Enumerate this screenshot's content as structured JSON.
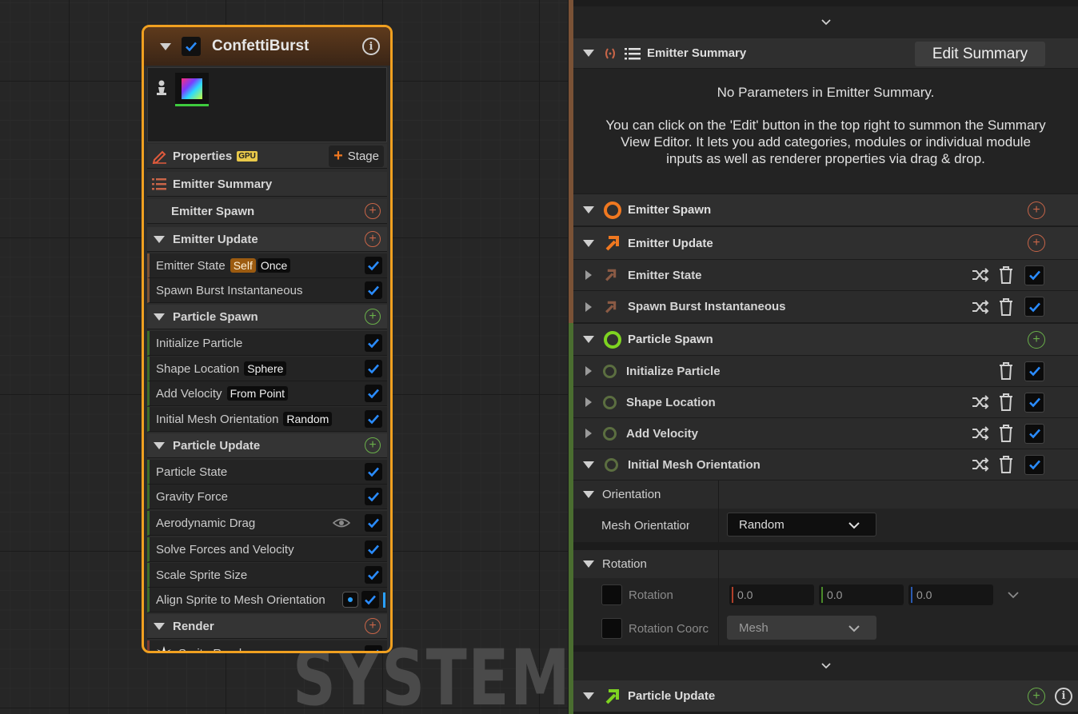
{
  "graph": {
    "watermark": "SYSTEM",
    "node": {
      "title": "ConfettiBurst",
      "properties_label": "Properties",
      "gpu_badge": "GPU",
      "stage_label": "Stage",
      "stage_plus": "+",
      "emitter_summary_label": "Emitter Summary",
      "emitter_spawn_label": "Emitter Spawn",
      "emitter_update_label": "Emitter Update",
      "emitter_state_label": "Emitter State",
      "emitter_state_badges": [
        "Self",
        "Once"
      ],
      "spawn_burst_label": "Spawn Burst Instantaneous",
      "particle_spawn_label": "Particle Spawn",
      "initialize_particle_label": "Initialize Particle",
      "shape_location_label": "Shape Location",
      "shape_location_badge": "Sphere",
      "add_velocity_label": "Add Velocity",
      "add_velocity_badge": "From Point",
      "initial_mesh_orientation_label": "Initial Mesh Orientation",
      "initial_mesh_orientation_badge": "Random",
      "particle_update_label": "Particle Update",
      "particle_state_label": "Particle State",
      "gravity_force_label": "Gravity Force",
      "aerodynamic_drag_label": "Aerodynamic Drag",
      "solve_forces_label": "Solve Forces and Velocity",
      "scale_sprite_label": "Scale Sprite Size",
      "align_sprite_label": "Align Sprite to Mesh Orientation",
      "render_label": "Render",
      "sprite_renderer_label": "Sprite Renderer",
      "info_glyph": "i",
      "plus_glyph": "+"
    }
  },
  "panel": {
    "emitter_summary": {
      "title": "Emitter Summary",
      "edit_button": "Edit Summary",
      "empty_title": "No Parameters in Emitter Summary.",
      "empty_body": "You can click on the 'Edit' button in the top right to summon the Summary View Editor. It lets you add categories, modules or individual module inputs as well as renderer properties via drag & drop."
    },
    "emitter_spawn": "Emitter Spawn",
    "emitter_update": "Emitter Update",
    "emitter_state": "Emitter State",
    "spawn_burst": "Spawn Burst Instantaneous",
    "particle_spawn": "Particle Spawn",
    "initialize_particle": "Initialize Particle",
    "shape_location": "Shape Location",
    "add_velocity": "Add Velocity",
    "initial_mesh_orientation": "Initial Mesh Orientation",
    "orientation_group": "Orientation",
    "mesh_orientation_label": "Mesh Orientation M",
    "mesh_orientation_value": "Random",
    "rotation_group": "Rotation",
    "rotation_label": "Rotation",
    "rotation_values": [
      "0.0",
      "0.0",
      "0.0"
    ],
    "rotation_coord_label": "Rotation Coorc",
    "rotation_coord_value": "Mesh",
    "particle_update": "Particle Update",
    "plus_glyph": "+",
    "info_glyph": "i"
  },
  "colors": {
    "node_border": "#f0a020",
    "checkbox_blue": "#2a8cff",
    "emitter_orange": "#f07820",
    "particle_green": "#7ed321",
    "add_red": "#c86548",
    "add_green": "#6ab04a"
  },
  "icons": [
    "collapse-arrow-icon",
    "checkbox-icon",
    "info-icon",
    "pin-icon",
    "pencil-icon",
    "plus-icon",
    "list-icon",
    "circle-icon",
    "arrow-icon",
    "shuffle-icon",
    "trash-icon",
    "eye-icon",
    "spark-icon",
    "chevron-down-icon",
    "link-icon"
  ]
}
